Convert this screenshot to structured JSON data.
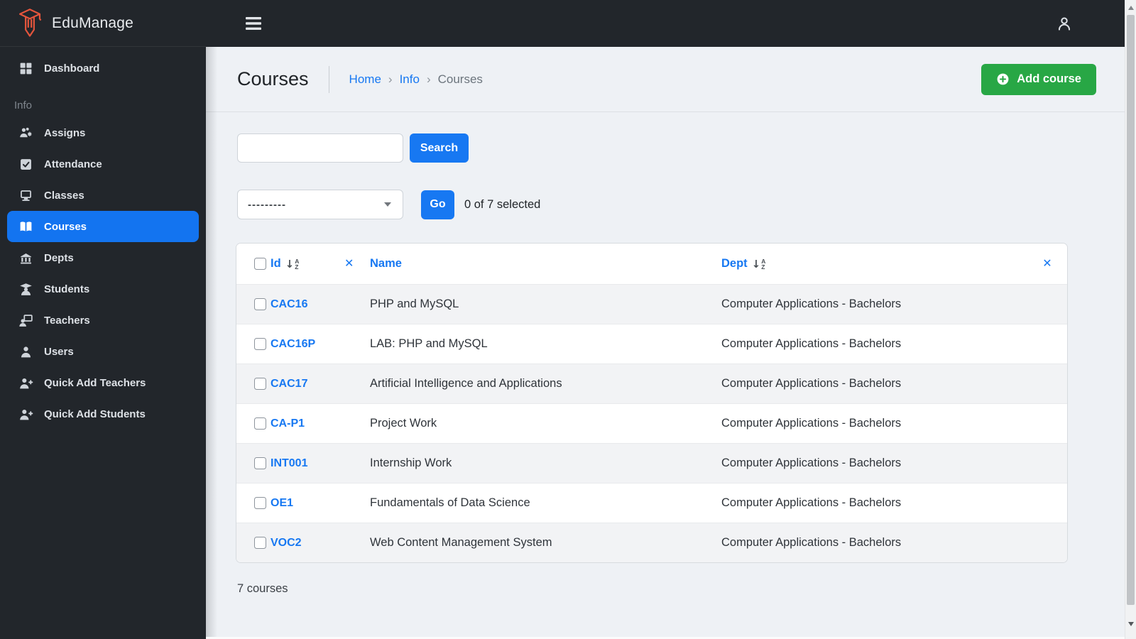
{
  "colors": {
    "accent": "#1778f2",
    "green": "#28a745",
    "sidebar": "#22262b",
    "pagebg": "#eef1f5",
    "logoaccent": "#e4553c"
  },
  "brand": {
    "name": "EduManage"
  },
  "sidebar": {
    "section_label": "Info",
    "items": [
      {
        "label": "Dashboard"
      },
      {
        "label": "Assigns"
      },
      {
        "label": "Attendance"
      },
      {
        "label": "Classes"
      },
      {
        "label": "Courses",
        "active": true
      },
      {
        "label": "Depts"
      },
      {
        "label": "Students"
      },
      {
        "label": "Teachers"
      },
      {
        "label": "Users"
      },
      {
        "label": "Quick Add Teachers"
      },
      {
        "label": "Quick Add Students"
      }
    ]
  },
  "page": {
    "title": "Courses",
    "breadcrumb": {
      "home": "Home",
      "section": "Info",
      "current": "Courses",
      "separator": "›"
    },
    "add_button": "Add course"
  },
  "search": {
    "value": "",
    "button": "Search"
  },
  "filter": {
    "select_value": "---------",
    "go_button": "Go",
    "status": "0 of 7 selected"
  },
  "table": {
    "columns": {
      "id": "Id",
      "name": "Name",
      "dept": "Dept"
    },
    "sort_arrow": "↓",
    "sort_a": "A",
    "sort_z": "Z",
    "clear_icon": "✕",
    "rows": [
      {
        "id": "CAC16",
        "name": "PHP and MySQL",
        "dept": "Computer Applications - Bachelors"
      },
      {
        "id": "CAC16P",
        "name": "LAB: PHP and MySQL",
        "dept": "Computer Applications - Bachelors"
      },
      {
        "id": "CAC17",
        "name": "Artificial Intelligence and Applications",
        "dept": "Computer Applications - Bachelors"
      },
      {
        "id": "CA-P1",
        "name": "Project Work",
        "dept": "Computer Applications - Bachelors"
      },
      {
        "id": "INT001",
        "name": "Internship Work",
        "dept": "Computer Applications - Bachelors"
      },
      {
        "id": "OE1",
        "name": "Fundamentals of Data Science",
        "dept": "Computer Applications - Bachelors"
      },
      {
        "id": "VOC2",
        "name": "Web Content Management System",
        "dept": "Computer Applications - Bachelors"
      }
    ],
    "footer": "7 courses"
  }
}
